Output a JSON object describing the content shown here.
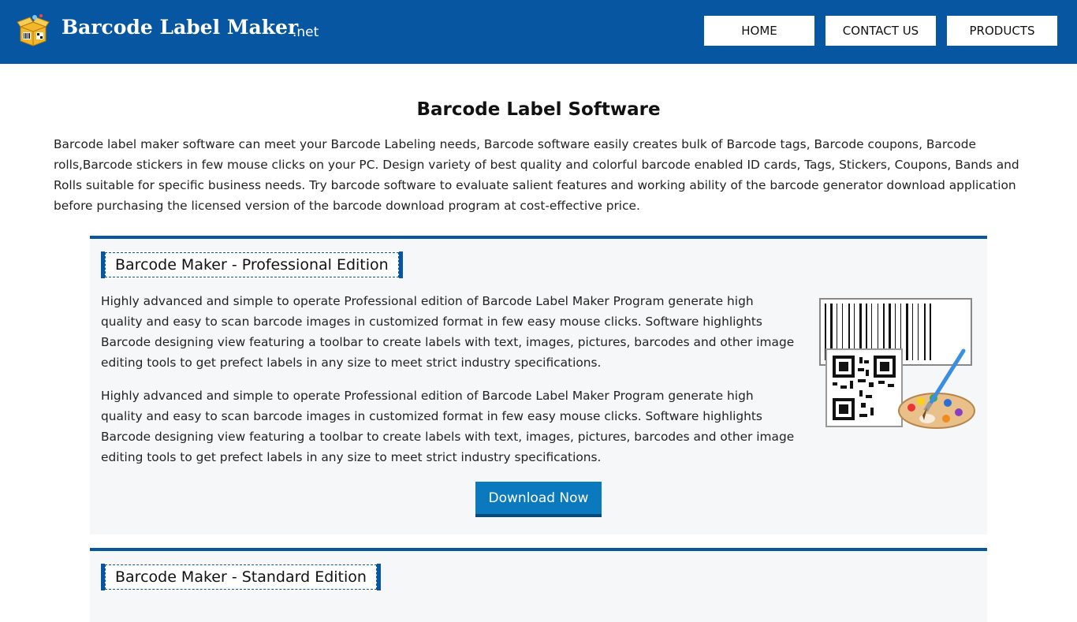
{
  "header": {
    "brand_name": "Barcode Label Maker",
    "brand_tld": ".net",
    "nav": {
      "home": "HOME",
      "contact": "CONTACT US",
      "products": "PRODUCTS"
    }
  },
  "intro": {
    "title": "Barcode Label Software",
    "text": "Barcode label maker software can meet your Barcode Labeling needs, Barcode software easily creates bulk of Barcode tags, Barcode coupons, Barcode rolls,Barcode stickers in few mouse clicks on your PC. Design variety of best quality and colorful barcode enabled ID cards, Tags, Stickers, Coupons, Bands and Rolls suitable for specific business needs. Try barcode software to evaluate salient features and working ability of the barcode generator download application before purchasing the licensed version of the barcode download program at cost-effective price."
  },
  "products": [
    {
      "heading": "Barcode Maker - Professional Edition",
      "paragraphs": [
        "Highly advanced and simple to operate Professional edition of Barcode Label Maker Program generate high quality and easy to scan barcode images in customized format in few easy mouse clicks. Software highlights Barcode designing view featuring a toolbar to create labels with text, images, pictures, barcodes and other image editing tools to get prefect labels in any size to meet strict industry specifications.",
        "Highly advanced and simple to operate Professional edition of Barcode Label Maker Program generate high quality and easy to scan barcode images in customized format in few easy mouse clicks. Software highlights Barcode designing view featuring a toolbar to create labels with text, images, pictures, barcodes and other image editing tools to get prefect labels in any size to meet strict industry specifications."
      ],
      "download_label": "Download Now"
    },
    {
      "heading": "Barcode Maker - Standard Edition"
    }
  ],
  "colors": {
    "header_bg": "#0756a1",
    "accent": "#0756a1",
    "download_button": "#0a79bd",
    "card_bg": "#f6f7f9"
  },
  "icons": {
    "logo": "barcode-box-logo-icon",
    "product_image": "barcode-qr-palette-icon"
  }
}
